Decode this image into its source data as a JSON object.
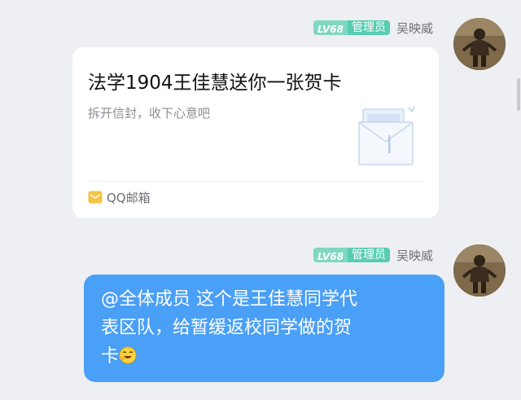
{
  "messages": [
    {
      "level_badge": "LV68",
      "role_badge": "管理员",
      "sender": "吴映威",
      "avatar_icon": "user-avatar-icon",
      "card": {
        "title": "法学1904王佳慧送你一张贺卡",
        "subtitle": "拆开信封，收下心意吧",
        "source": "QQ邮箱",
        "preview_icon": "envelope-card-icon",
        "source_icon": "qq-mail-icon"
      }
    },
    {
      "level_badge": "LV68",
      "role_badge": "管理员",
      "sender": "吴映威",
      "avatar_icon": "user-avatar-icon",
      "text_lines": [
        "@全体成员 这个是王佳慧同学代",
        "表区队，给暂缓返校同学做的贺",
        "卡"
      ],
      "emoji": "laughing-face-emoji"
    }
  ],
  "colors": {
    "background": "#eeeff3",
    "bubble": "#4a9ff6",
    "level_badge": "#7fd7c1",
    "role_badge": "#57cdb1",
    "card": "#ffffff"
  }
}
